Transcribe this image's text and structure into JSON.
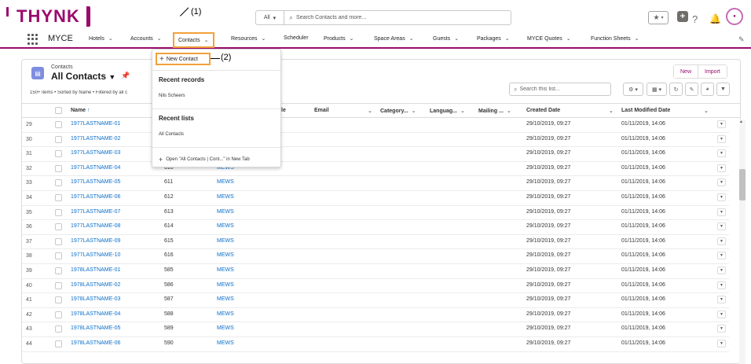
{
  "brand": {
    "logo_text": "THYNK"
  },
  "search": {
    "scope": "All",
    "placeholder": "Search Contacts and more..."
  },
  "nav": {
    "app_name": "MYCE",
    "items": [
      {
        "label": "Hotels"
      },
      {
        "label": "Accounts"
      },
      {
        "label": "Contacts"
      },
      {
        "label": "Resources"
      },
      {
        "label": "Scheduler"
      },
      {
        "label": "Products"
      },
      {
        "label": "Space Areas"
      },
      {
        "label": "Guests"
      },
      {
        "label": "Packages"
      },
      {
        "label": "MYCE Quotes"
      },
      {
        "label": "Function Sheets"
      }
    ]
  },
  "annotations": {
    "a1": "(1)",
    "a2": "(2)"
  },
  "dropdown": {
    "new_contact": "New Contact",
    "recent_records_header": "Recent records",
    "recent_record": "Nils Scheers",
    "recent_lists_header": "Recent lists",
    "recent_list": "All Contacts",
    "open_new_tab": "Open \"All Contacts | Cont...\" in New Tab"
  },
  "listview": {
    "object": "Contacts",
    "title": "All Contacts",
    "meta": "150+ items • Sorted by Name • Filtered by all c",
    "new_button": "New",
    "import_button": "Import",
    "search_placeholder": "Search this list...",
    "columns": {
      "name": "Name",
      "c_le": "le",
      "email": "Email",
      "category": "Category...",
      "language": "Languag...",
      "mailing": "Mailing ...",
      "created": "Created Date",
      "modified": "Last Modified Date"
    },
    "rows": [
      {
        "num": "29",
        "name": "1977LASTNAME-01",
        "c3": "",
        "c4": "",
        "created": "29/10/2019, 09:27",
        "modified": "01/11/2019, 14:06"
      },
      {
        "num": "30",
        "name": "1977LASTNAME-02",
        "c3": "",
        "c4": "",
        "created": "29/10/2019, 09:27",
        "modified": "01/11/2019, 14:06"
      },
      {
        "num": "31",
        "name": "1977LASTNAME-03",
        "c3": "",
        "c4": "",
        "created": "29/10/2019, 09:27",
        "modified": "01/11/2019, 14:06"
      },
      {
        "num": "32",
        "name": "1977LASTNAME-04",
        "c3": "610",
        "c4": "MEWS",
        "created": "29/10/2019, 09:27",
        "modified": "01/11/2019, 14:06"
      },
      {
        "num": "33",
        "name": "1977LASTNAME-05",
        "c3": "611",
        "c4": "MEWS",
        "created": "29/10/2019, 09:27",
        "modified": "01/11/2019, 14:06"
      },
      {
        "num": "34",
        "name": "1977LASTNAME-06",
        "c3": "612",
        "c4": "MEWS",
        "created": "29/10/2019, 09:27",
        "modified": "01/11/2019, 14:06"
      },
      {
        "num": "35",
        "name": "1977LASTNAME-07",
        "c3": "613",
        "c4": "MEWS",
        "created": "29/10/2019, 09:27",
        "modified": "01/11/2019, 14:06"
      },
      {
        "num": "36",
        "name": "1977LASTNAME-08",
        "c3": "614",
        "c4": "MEWS",
        "created": "29/10/2019, 09:27",
        "modified": "01/11/2019, 14:06"
      },
      {
        "num": "37",
        "name": "1977LASTNAME-09",
        "c3": "615",
        "c4": "MEWS",
        "created": "29/10/2019, 09:27",
        "modified": "01/11/2019, 14:06"
      },
      {
        "num": "38",
        "name": "1977LASTNAME-10",
        "c3": "616",
        "c4": "MEWS",
        "created": "29/10/2019, 09:27",
        "modified": "01/11/2019, 14:06"
      },
      {
        "num": "39",
        "name": "1978LASTNAME-01",
        "c3": "585",
        "c4": "MEWS",
        "created": "29/10/2019, 09:27",
        "modified": "01/11/2019, 14:06"
      },
      {
        "num": "40",
        "name": "1978LASTNAME-02",
        "c3": "586",
        "c4": "MEWS",
        "created": "29/10/2019, 09:27",
        "modified": "01/11/2019, 14:06"
      },
      {
        "num": "41",
        "name": "1978LASTNAME-03",
        "c3": "587",
        "c4": "MEWS",
        "created": "29/10/2019, 09:27",
        "modified": "01/11/2019, 14:06"
      },
      {
        "num": "42",
        "name": "1978LASTNAME-04",
        "c3": "588",
        "c4": "MEWS",
        "created": "29/10/2019, 09:27",
        "modified": "01/11/2019, 14:06"
      },
      {
        "num": "43",
        "name": "1978LASTNAME-05",
        "c3": "589",
        "c4": "MEWS",
        "created": "29/10/2019, 09:27",
        "modified": "01/11/2019, 14:06"
      },
      {
        "num": "44",
        "name": "1978LASTNAME-06",
        "c3": "590",
        "c4": "MEWS",
        "created": "29/10/2019, 09:27",
        "modified": "01/11/2019, 14:06"
      }
    ]
  },
  "colors": {
    "brand": "#9b0b6d",
    "highlight": "#f2a13a",
    "link": "#0b6fc9",
    "object_icon": "#7f8de1"
  },
  "icons": [
    "search-icon",
    "star-icon",
    "plus-icon",
    "help-icon",
    "bell-icon",
    "waffle-icon",
    "pencil-icon",
    "pin-icon",
    "gear-icon",
    "refresh-icon",
    "filter-icon",
    "chart-icon"
  ]
}
